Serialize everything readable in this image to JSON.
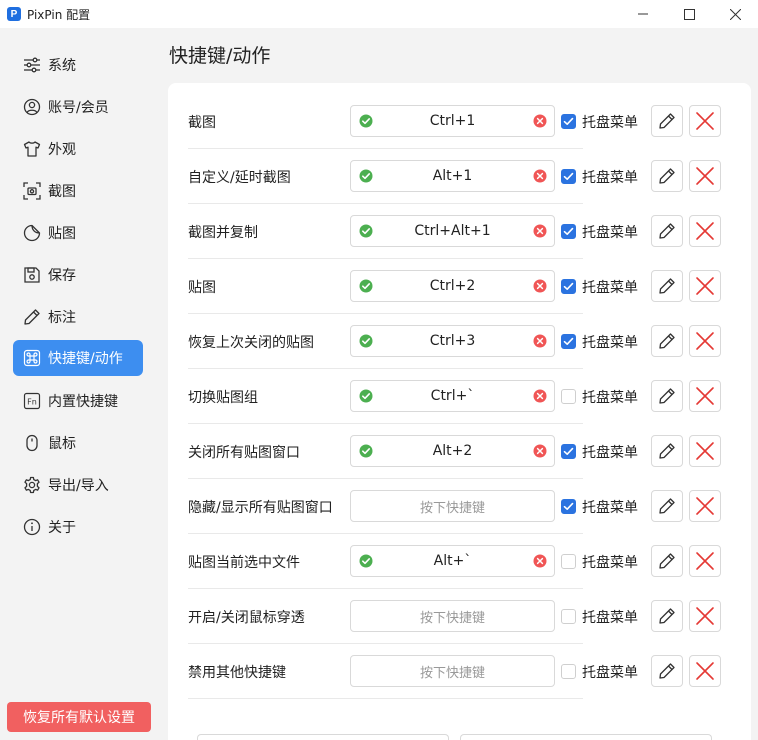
{
  "window": {
    "logo_letter": "P",
    "title": "PixPin 配置"
  },
  "sidebar": {
    "items": [
      {
        "label": "系统",
        "icon": "sliders-icon"
      },
      {
        "label": "账号/会员",
        "icon": "user-circle-icon"
      },
      {
        "label": "外观",
        "icon": "shirt-icon"
      },
      {
        "label": "截图",
        "icon": "screenshot-icon"
      },
      {
        "label": "贴图",
        "icon": "sticker-icon"
      },
      {
        "label": "保存",
        "icon": "save-icon"
      },
      {
        "label": "标注",
        "icon": "pencil-icon"
      },
      {
        "label": "快捷键/动作",
        "icon": "command-key-icon",
        "active": true
      },
      {
        "label": "内置快捷键",
        "icon": "fn-key-icon"
      },
      {
        "label": "鼠标",
        "icon": "mouse-icon"
      },
      {
        "label": "导出/导入",
        "icon": "gear-icon"
      },
      {
        "label": "关于",
        "icon": "info-icon"
      }
    ],
    "reset_label": "恢复所有默认设置"
  },
  "main": {
    "title": "快捷键/动作",
    "tray_label": "托盘菜单",
    "placeholder": "按下快捷键",
    "rows": [
      {
        "label": "截图",
        "hotkey": "Ctrl+1",
        "tray": true
      },
      {
        "label": "自定义/延时截图",
        "hotkey": "Alt+1",
        "tray": true
      },
      {
        "label": "截图并复制",
        "hotkey": "Ctrl+Alt+1",
        "tray": true
      },
      {
        "label": "贴图",
        "hotkey": "Ctrl+2",
        "tray": true
      },
      {
        "label": "恢复上次关闭的贴图",
        "hotkey": "Ctrl+3",
        "tray": true
      },
      {
        "label": "切换贴图组",
        "hotkey": "Ctrl+`",
        "tray": false
      },
      {
        "label": "关闭所有贴图窗口",
        "hotkey": "Alt+2",
        "tray": true
      },
      {
        "label": "隐藏/显示所有贴图窗口",
        "hotkey": "",
        "tray": true
      },
      {
        "label": "贴图当前选中文件",
        "hotkey": "Alt+`",
        "tray": false
      },
      {
        "label": "开启/关闭鼠标穿透",
        "hotkey": "",
        "tray": false
      },
      {
        "label": "禁用其他快捷键",
        "hotkey": "",
        "tray": false
      }
    ]
  },
  "colors": {
    "accent": "#3d8ef0",
    "check": "#2b73e0",
    "ok_green": "#4caf50",
    "clear_red": "#f05555",
    "delete_red": "#e53935",
    "reset_red": "#f16060"
  }
}
